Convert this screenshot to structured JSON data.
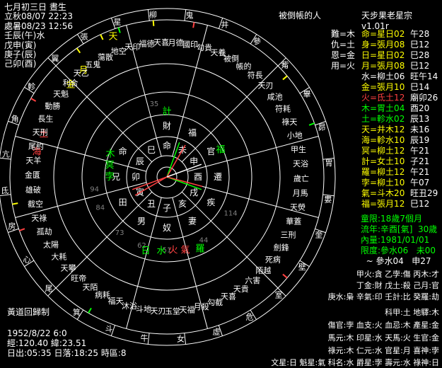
{
  "header": {
    "line1": "七月初三日 晝生",
    "line2": "立秋08/07 22:23",
    "line3": "處暑08/23 12:56",
    "line4": "壬辰(午)水",
    "line5": "戊申(寅)",
    "line6": "庚子(辰)",
    "line7": "己卯(酉)"
  },
  "title": "被倒帳的人",
  "version": "天步果老星宗 v1.01r",
  "right_panel": {
    "left_col": [
      "難=木",
      "仇=土",
      "恩=金",
      "用=火"
    ],
    "planets": [
      {
        "text": "命=星日02",
        "tail": "午28",
        "color": "#ffff00"
      },
      {
        "text": "身=張月08",
        "tail": "巳12",
        "color": "#ffff00"
      },
      {
        "text": "日=星日02",
        "tail": "巳28",
        "color": "#ffff00"
      },
      {
        "text": "月=張月08",
        "tail": "巳12",
        "color": "#ffff00"
      },
      {
        "text": "水=柳土06",
        "tail": "旺午14",
        "color": "#ffffff"
      },
      {
        "text": "金=張月10",
        "tail": "巳14",
        "color": "#ffff00"
      },
      {
        "text": "火=氐土12",
        "tail": "廟卯26",
        "color": "#ff4040"
      },
      {
        "text": "木=胃土04",
        "tail": "酉20",
        "color": "#00ff00"
      },
      {
        "text": "土=軫水02",
        "tail": "辰13",
        "color": "#00ff00"
      },
      {
        "text": "天=井木12",
        "tail": "未16",
        "color": "#ffff00"
      },
      {
        "text": "海=軫水10",
        "tail": "辰19",
        "color": "#ffff00"
      },
      {
        "text": "冥=柳土12",
        "tail": "午21",
        "color": "#ffff00"
      },
      {
        "text": "計=女土10",
        "tail": "子21",
        "color": "#ffff00"
      },
      {
        "text": "羅=柳土12",
        "tail": "午21",
        "color": "#ffff00"
      },
      {
        "text": "孛=柳土10",
        "tail": "午07",
        "color": "#ffff00"
      },
      {
        "text": "氣=斗木20",
        "tail": "旺丑29",
        "color": "#ffff00"
      },
      {
        "text": "福=張月12",
        "tail": "巳12",
        "color": "#ffff00"
      }
    ],
    "tong_xian": "童限:18歲7個月",
    "liu_nian": "流年:辛酉[氣]  30歲",
    "nei_yue": "內量:1981/01/01",
    "xian_du": "限度:參水06   未00",
    "xian_du2": "  ~ 參水04   申27",
    "lower": [
      "甲火:貪 乙孛:傷 丙木:才",
      "丁金:財 戊土:殺 己月:官",
      "庚水:梟 辛氣:印 壬計:比 癸羅:劫",
      "科甲:土 地驛:木",
      "傷官:孛 血支:火 血忌:木 產星:金",
      "馬元:木 印星:水 天馬:火 生官:金",
      "祿元:木 仁元:水 官星:月 喜神:孛",
      "文星:日 魁星:氣 科名:水 爵星:孛 壽元:水 祿神:日"
    ]
  },
  "footer": {
    "mode": "黃道回歸制",
    "date": "1952/8/22 6:0",
    "geo": "經:120.40 緯:23.51",
    "sun": "日出:05:35 日落:18:25 時區:8"
  },
  "chart": {
    "mansions": [
      "柳",
      "鬼",
      "井",
      "參",
      "觜",
      "畢",
      "昴",
      "胃",
      "婁",
      "奎",
      "壁",
      "室",
      "危",
      "虛",
      "女",
      "牛",
      "斗",
      "箕",
      "尾",
      "心",
      "房",
      "氐",
      "亢",
      "角",
      "軫",
      "翼",
      "張",
      "星"
    ],
    "branches": [
      "命",
      "未",
      "申",
      "酉",
      "戌",
      "亥",
      "子",
      "丑",
      "寅",
      "卯",
      "辰",
      "巳"
    ],
    "houses": [
      "財",
      "福",
      "官",
      "遷",
      "疾",
      "妻",
      "奴",
      "男",
      "田",
      "兄",
      "命"
    ],
    "center_labels": [
      "午",
      "未",
      "申",
      "酉",
      "戌",
      "亥",
      "子",
      "丑",
      "寅",
      "卯",
      "辰",
      "巳"
    ],
    "numbers": [
      "35",
      "94",
      "84",
      "73",
      "62",
      "51",
      "44",
      "114"
    ],
    "stars_inner": [
      "計",
      "天",
      "福",
      "日",
      "水",
      "火",
      "氣",
      "羅",
      "木",
      "土",
      "冥",
      "孛",
      "海",
      "月",
      "金"
    ],
    "text_blocks": [
      "國印",
      "勾貴",
      "天養",
      "被倒",
      "帳的",
      "符長",
      "天刃",
      "咸池",
      "符耗",
      "祿天",
      "小地",
      "甲生",
      "天浴",
      "歲亡",
      "月馬",
      "天熒",
      "華蓋",
      "三刑",
      "劍鋒",
      "死病",
      "陌越",
      "六害",
      "天貴",
      "天喜",
      "勾截",
      "月殺",
      "天福",
      "玉堂",
      "天刃",
      "斗地",
      "沐浴",
      "福天",
      "病耗",
      "天陌",
      "旺帝",
      "天攀",
      "大耗",
      "太陽",
      "孤劫",
      "天祿",
      "截空",
      "雄破",
      "金匱",
      "天羊",
      "尾約",
      "天刑",
      "長生",
      "動勝",
      "天魁",
      "利合",
      "天乙",
      "五鬼",
      "蕩散",
      "地空",
      "天印",
      "福德",
      "天喜",
      "月德"
    ]
  }
}
